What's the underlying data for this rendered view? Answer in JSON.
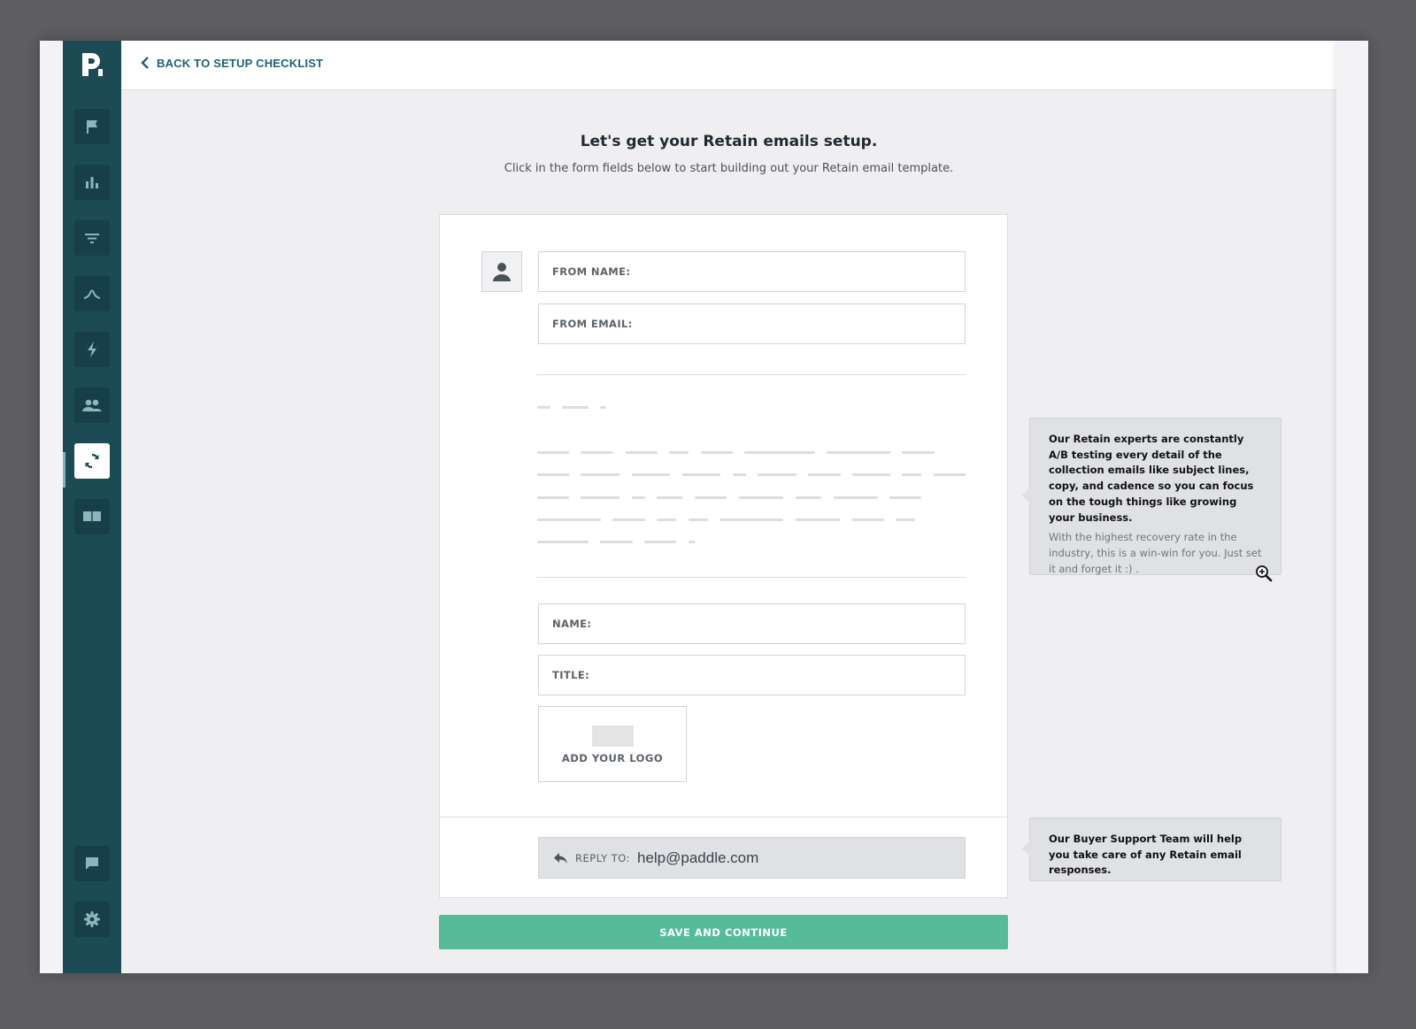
{
  "topbar": {
    "back_label": "BACK TO SETUP CHECKLIST"
  },
  "sidebar": {
    "items": [
      {
        "icon": "flag-icon",
        "name": "nav-flag"
      },
      {
        "icon": "bar-chart-icon",
        "name": "nav-analytics"
      },
      {
        "icon": "filter-icon",
        "name": "nav-filter"
      },
      {
        "icon": "curve-icon",
        "name": "nav-curve"
      },
      {
        "icon": "lightning-icon",
        "name": "nav-lightning"
      },
      {
        "icon": "people-icon",
        "name": "nav-people"
      },
      {
        "icon": "refresh-icon",
        "name": "nav-retain",
        "active": true
      },
      {
        "icon": "book-icon",
        "name": "nav-book"
      },
      {
        "icon": "chat-icon",
        "name": "nav-chat"
      },
      {
        "icon": "gear-icon",
        "name": "nav-settings"
      }
    ]
  },
  "main": {
    "heading": "Let's get your Retain emails setup.",
    "subheading": "Click in the form fields below to start building out your Retain email template."
  },
  "form": {
    "from_name_label": "FROM NAME:",
    "from_email_label": "FROM EMAIL:",
    "name_label": "NAME:",
    "title_label": "TITLE:",
    "logo_label": "ADD YOUR LOGO",
    "reply_label": "REPLY TO:",
    "reply_value": "help@paddle.com",
    "save_label": "SAVE AND CONTINUE"
  },
  "tips": {
    "retain_bold": "Our Retain experts are constantly A/B testing every detail of the collection emails like subject lines, copy, and cadence so you can focus on the tough things like growing your business.",
    "retain_normal": "With the highest recovery rate in the industry, this is a win-win for you. Just set it and forget it :) .",
    "support_bold": "Our Buyer Support Team will help you take care of any Retain email responses."
  },
  "colors": {
    "sidebar": "#1c4a55",
    "accent": "#1d6372",
    "save_button": "#55bb98",
    "tip_background": "#dfe1e5"
  }
}
